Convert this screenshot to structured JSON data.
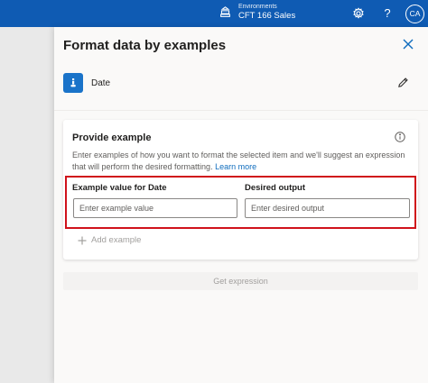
{
  "topbar": {
    "env_label": "Environments",
    "env_name": "CFT 166 Sales",
    "settings_icon": "gear-icon",
    "help_icon": "help-icon",
    "help_glyph": "?",
    "avatar_initials": "CA",
    "bar_color": "#0f5bb3"
  },
  "panel": {
    "title": "Format data by examples",
    "close_icon": "close-icon",
    "item_label": "Date",
    "item_icon": "variable-icon",
    "edit_icon": "pencil-icon"
  },
  "card": {
    "title": "Provide example",
    "info_icon": "info-icon",
    "description": "Enter examples of how you want to format the selected item and we'll suggest an expression that will perform the desired formatting.",
    "learn_more": "Learn more",
    "example_label": "Example value for Date",
    "output_label": "Desired output",
    "example_placeholder": "Enter example value",
    "output_placeholder": "Enter desired output",
    "add_example": "Add example",
    "highlight_color": "#d0121b"
  },
  "actions": {
    "get_expression": "Get expression"
  }
}
